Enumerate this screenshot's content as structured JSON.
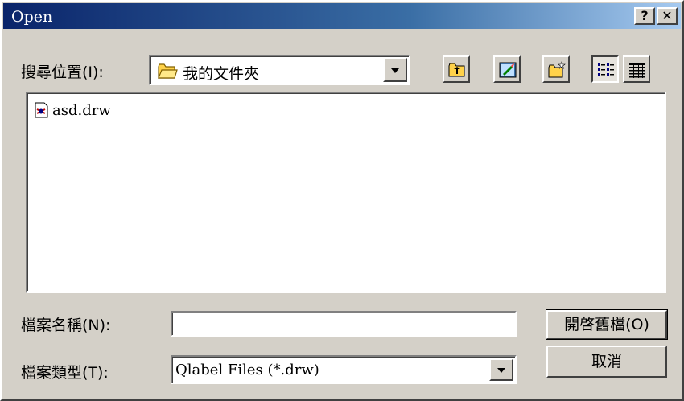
{
  "window": {
    "title": "Open",
    "help_label": "?",
    "close_label": "✕"
  },
  "look_in": {
    "label": "搜尋位置(I):",
    "value": "我的文件夾",
    "folder_icon": "open-folder-icon"
  },
  "toolbar": {
    "buttons": [
      {
        "name": "up-one-level-icon"
      },
      {
        "name": "desktop-icon"
      },
      {
        "name": "new-folder-icon"
      },
      {
        "name": "list-view-icon"
      },
      {
        "name": "details-view-icon"
      }
    ]
  },
  "files": [
    {
      "name": "asd.drw",
      "icon": "drawing-file-icon"
    }
  ],
  "filename": {
    "label": "檔案名稱(N):",
    "value": "",
    "placeholder": ""
  },
  "filetype": {
    "label": "檔案類型(T):",
    "value": "Qlabel Files (*.drw)"
  },
  "buttons": {
    "open": "開啓舊檔(O)",
    "cancel": "取消"
  },
  "colors": {
    "title_start": "#0a246a",
    "title_end": "#a6caf0",
    "face": "#d4d0c8"
  }
}
